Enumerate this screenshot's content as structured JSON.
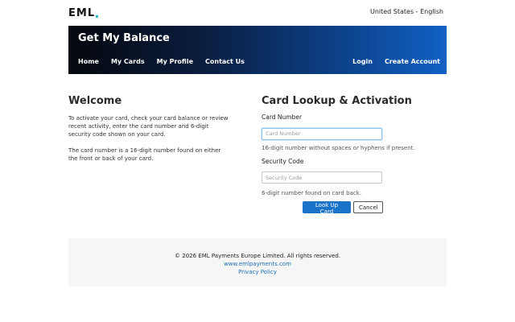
{
  "header": {
    "logo_text": "EML",
    "language": "United States - English"
  },
  "banner": {
    "title": "Get My Balance",
    "nav_left": [
      "Home",
      "My Cards",
      "My Profile",
      "Contact Us"
    ],
    "nav_right": [
      "Login",
      "Create Account"
    ]
  },
  "welcome": {
    "title": "Welcome",
    "para1": "To activate your card, check your card balance or review recent activity, enter the card number and 6-digit security code shown on your card.",
    "para2": "The card number is a 16-digit number found on either the front or back of your card."
  },
  "lookup": {
    "title": "Card Lookup & Activation",
    "card_label": "Card Number",
    "card_placeholder": "Card Number",
    "card_value": "",
    "card_hint": "16-digit number without spaces or hyphens if present.",
    "code_label": "Security Code",
    "code_placeholder": "Security Code",
    "code_value": "",
    "code_hint": "6-digit number found on card back.",
    "submit_label": "Look Up Card",
    "cancel_label": "Cancel"
  },
  "footer": {
    "copyright": "© 2026 EML Payments Europe Limited. All rights reserved.",
    "website": "www.emlpayments.com",
    "privacy": "Privacy Policy"
  },
  "colors": {
    "accent": "#1a72c9",
    "logo_dot": "#1fb6c9",
    "banner_dark": "#05070d",
    "banner_light": "#1161c4"
  }
}
